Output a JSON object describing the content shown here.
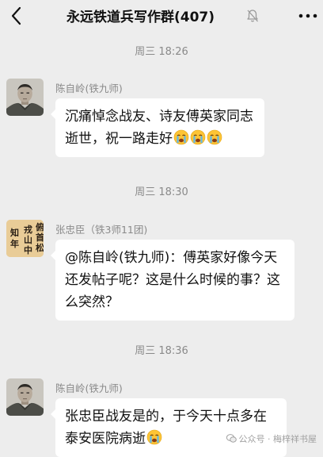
{
  "header": {
    "title": "永远铁道兵写作群(407)",
    "back_icon": "chevron-left-icon",
    "mute_icon": "bell-off-icon",
    "more_icon": "more-dots-icon"
  },
  "messages": [
    {
      "time": "周三 18:26",
      "sender": "陈自岭(铁九师)",
      "avatar": "soldier-portrait",
      "text": "沉痛悼念战友、诗友傅英家同志逝世，祝一路走好",
      "emoji_count": 3,
      "emoji_name": "crying-face-emoji"
    },
    {
      "time": "周三 18:30",
      "sender": "张忠臣（铁3师11团)",
      "avatar": "calligraphy",
      "avatar_text": "知 戎 俯\n年 山 首\n   中 松",
      "text": "@陈自岭(铁九师)：傅英家好像今天还发帖子呢？这是什么时候的事？这么突然？"
    },
    {
      "time": "周三 18:36",
      "sender": "陈自岭(铁九师)",
      "avatar": "soldier-portrait",
      "text": "张忠臣战友是的，于今天十点多在泰安医院病逝",
      "emoji_count": 1,
      "emoji_name": "crying-face-emoji"
    }
  ],
  "watermark": {
    "text": "公众号 · 梅梓祥书屋",
    "icon": "wechat-official-icon"
  }
}
